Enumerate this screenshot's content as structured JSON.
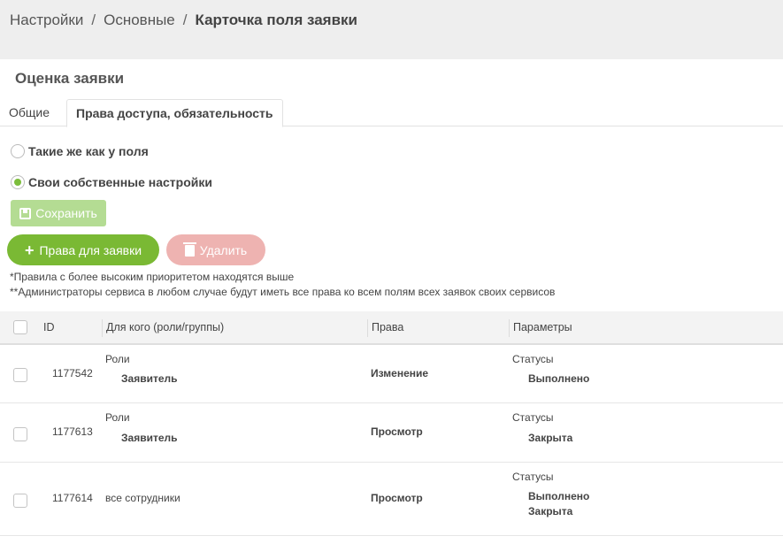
{
  "breadcrumb": {
    "items": [
      "Настройки",
      "Основные"
    ],
    "separator": "/",
    "current": "Карточка поля заявки"
  },
  "page_title": "Оценка заявки",
  "tabs": [
    {
      "label": "Общие",
      "active": false
    },
    {
      "label": "Права доступа, обязательность",
      "active": true
    }
  ],
  "radio_options": [
    {
      "label": "Такие же как у поля",
      "checked": false
    },
    {
      "label": "Свои собственные настройки",
      "checked": true
    }
  ],
  "buttons": {
    "save": "Сохранить",
    "add": "Права для заявки",
    "delete": "Удалить"
  },
  "notes": [
    "*Правила с более высоким приоритетом находятся выше",
    "**Администраторы сервиса в любом случае будут иметь все права ко всем полям всех заявок своих сервисов"
  ],
  "table": {
    "columns": [
      "ID",
      "Для кого (роли/группы)",
      "Права",
      "Параметры"
    ],
    "rows": [
      {
        "id": "1177542",
        "who_title": "Роли",
        "who_values": [
          "Заявитель"
        ],
        "rights": "Изменение",
        "param_title": "Статусы",
        "param_values": [
          "Выполнено"
        ]
      },
      {
        "id": "1177613",
        "who_title": "Роли",
        "who_values": [
          "Заявитель"
        ],
        "rights": "Просмотр",
        "param_title": "Статусы",
        "param_values": [
          "Закрыта"
        ]
      },
      {
        "id": "1177614",
        "who_title": "все сотрудники",
        "who_values": [],
        "rights": "Просмотр",
        "param_title": "Статусы",
        "param_values": [
          "Выполнено",
          "Закрыта"
        ]
      }
    ]
  },
  "colors": {
    "accent_green": "#7ab934",
    "save_disabled": "#b4dc93",
    "delete_disabled": "#eeb3b1",
    "breadcrumb_bg": "#eeeeee"
  }
}
